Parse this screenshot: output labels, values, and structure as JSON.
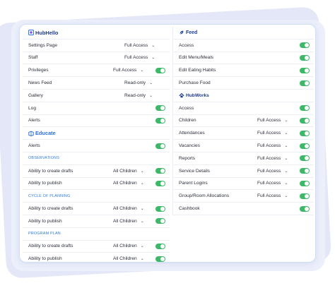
{
  "hubhello": {
    "brand": "HubHello",
    "rows": [
      {
        "label": "Settings Page",
        "access": "Full Access",
        "toggle": false
      },
      {
        "label": "Staff",
        "access": "Full Access",
        "toggle": false
      },
      {
        "label": "Privileges",
        "access": "Full Access",
        "toggle": true
      },
      {
        "label": "News Feed",
        "access": "Read-only",
        "toggle": false
      },
      {
        "label": "Gallery",
        "access": "Read-only",
        "toggle": false
      },
      {
        "label": "Log",
        "access": "",
        "toggle": true
      },
      {
        "label": "Alerts",
        "access": "",
        "toggle": true
      }
    ]
  },
  "educate": {
    "brand": "Educate",
    "alerts_label": "Alerts",
    "groups": [
      {
        "heading": "OBSERVATIONS",
        "rows": [
          {
            "label": "Ability to create drafts",
            "access": "All Children"
          },
          {
            "label": "Ability to publish",
            "access": "All Children"
          }
        ]
      },
      {
        "heading": "CYCLE OF PLANNING",
        "rows": [
          {
            "label": "Ability to create drafts",
            "access": "All Children"
          },
          {
            "label": "Ability to publish",
            "access": "All Children"
          }
        ]
      },
      {
        "heading": "PROGRAM PLAN",
        "rows": [
          {
            "label": "Ability to create drafts",
            "access": "All Children"
          },
          {
            "label": "Ability to publish",
            "access": "All Children"
          }
        ]
      }
    ]
  },
  "feed": {
    "brand": "Feed",
    "rows": [
      {
        "label": "Access"
      },
      {
        "label": "Edit Menu/Meals"
      },
      {
        "label": "Edit Eating Habits"
      },
      {
        "label": "Purchase Food"
      }
    ]
  },
  "hubworks": {
    "brand": "HubWorks",
    "rows": [
      {
        "label": "Access",
        "access": ""
      },
      {
        "label": "Children",
        "access": "Full Access"
      },
      {
        "label": "Attendances",
        "access": "Full Access"
      },
      {
        "label": "Vacancies",
        "access": "Full Access"
      },
      {
        "label": "Reports",
        "access": "Full Access"
      },
      {
        "label": "Service Details",
        "access": "Full Access"
      },
      {
        "label": "Parent Logins",
        "access": "Full Access"
      },
      {
        "label": "Group/Room Allocations",
        "access": "Full Access"
      },
      {
        "label": "Cashbook",
        "access": ""
      }
    ]
  },
  "colors": {
    "toggle_on": "#3cb868",
    "brand_blue": "#1d3a8a",
    "accent_blue": "#2f7be0"
  }
}
